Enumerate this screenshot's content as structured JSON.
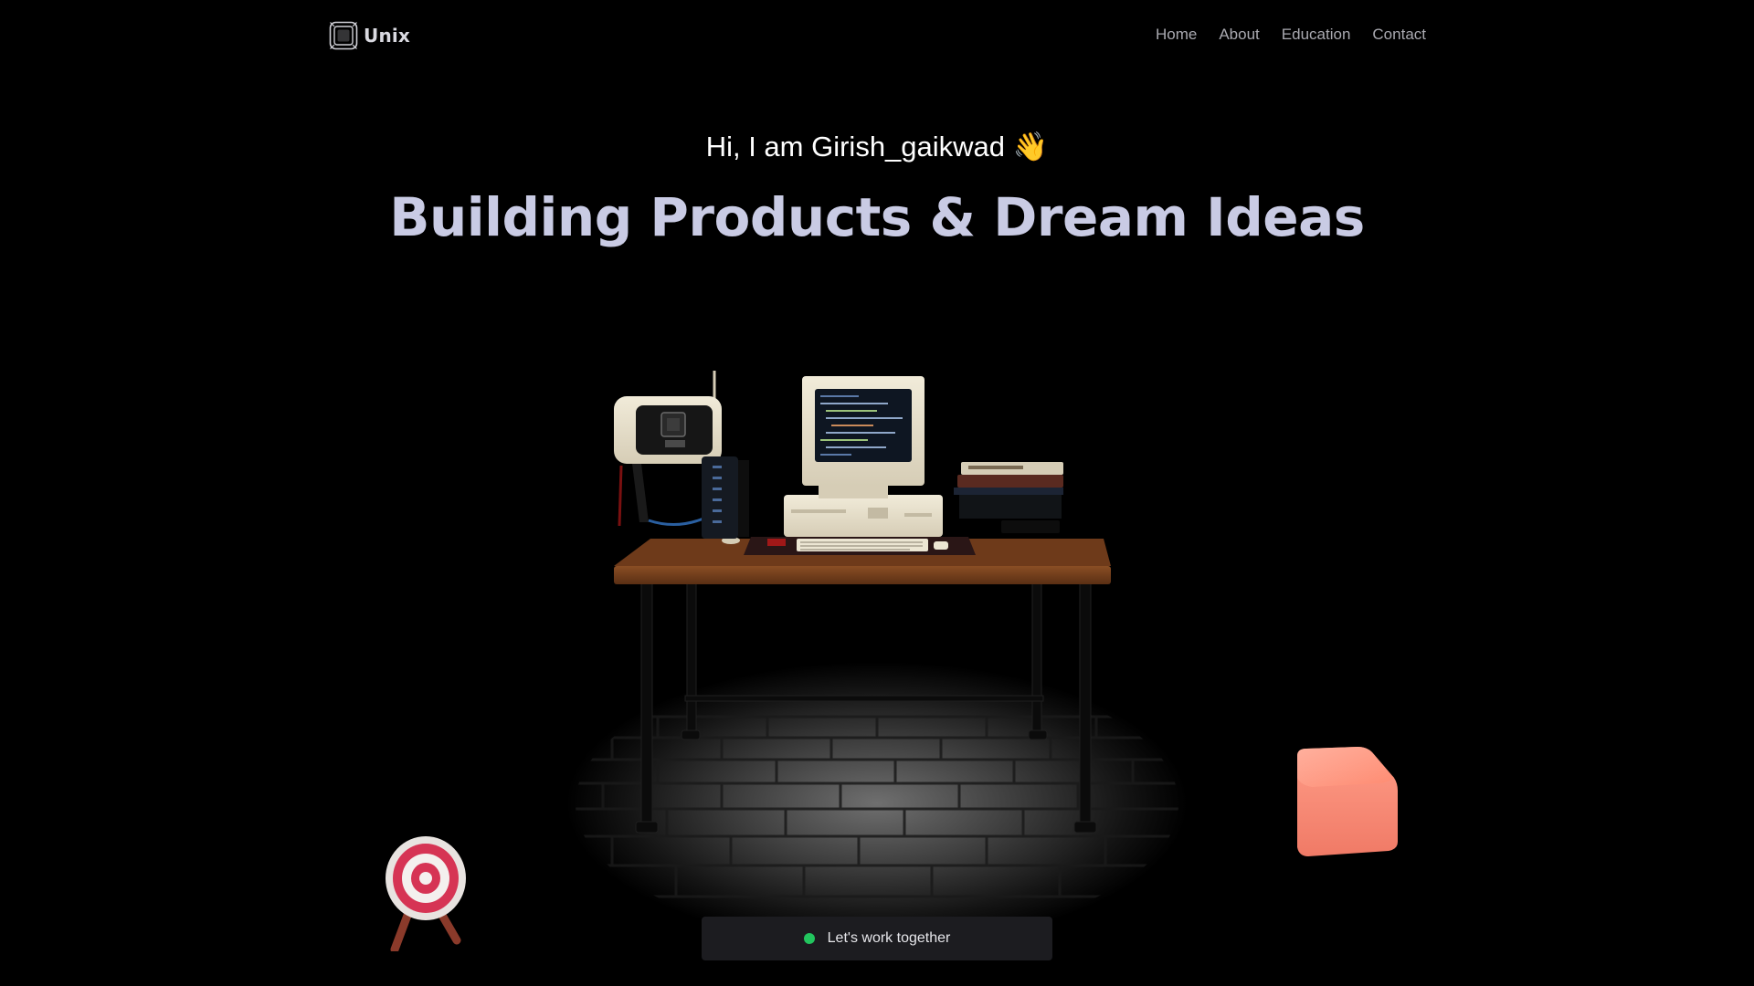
{
  "brand": {
    "name": "Unix",
    "icon": "unix-logo-icon"
  },
  "nav": {
    "items": [
      "Home",
      "About",
      "Education",
      "Contact"
    ]
  },
  "hero": {
    "greeting": "Hi, I am Girish_gaikwad",
    "wave_emoji": "👋",
    "headline": "Building Products & Dream Ideas"
  },
  "scene": {
    "description_icons": [
      "retro-desk-setup",
      "target-icon",
      "cube-icon"
    ]
  },
  "cta": {
    "label": "Let's work together",
    "status_color": "#22c55e"
  },
  "colors": {
    "background": "#000000",
    "headline": "#c9cbe4",
    "nav_text": "#a9a9b0",
    "cta_bg": "#1c1c20"
  }
}
